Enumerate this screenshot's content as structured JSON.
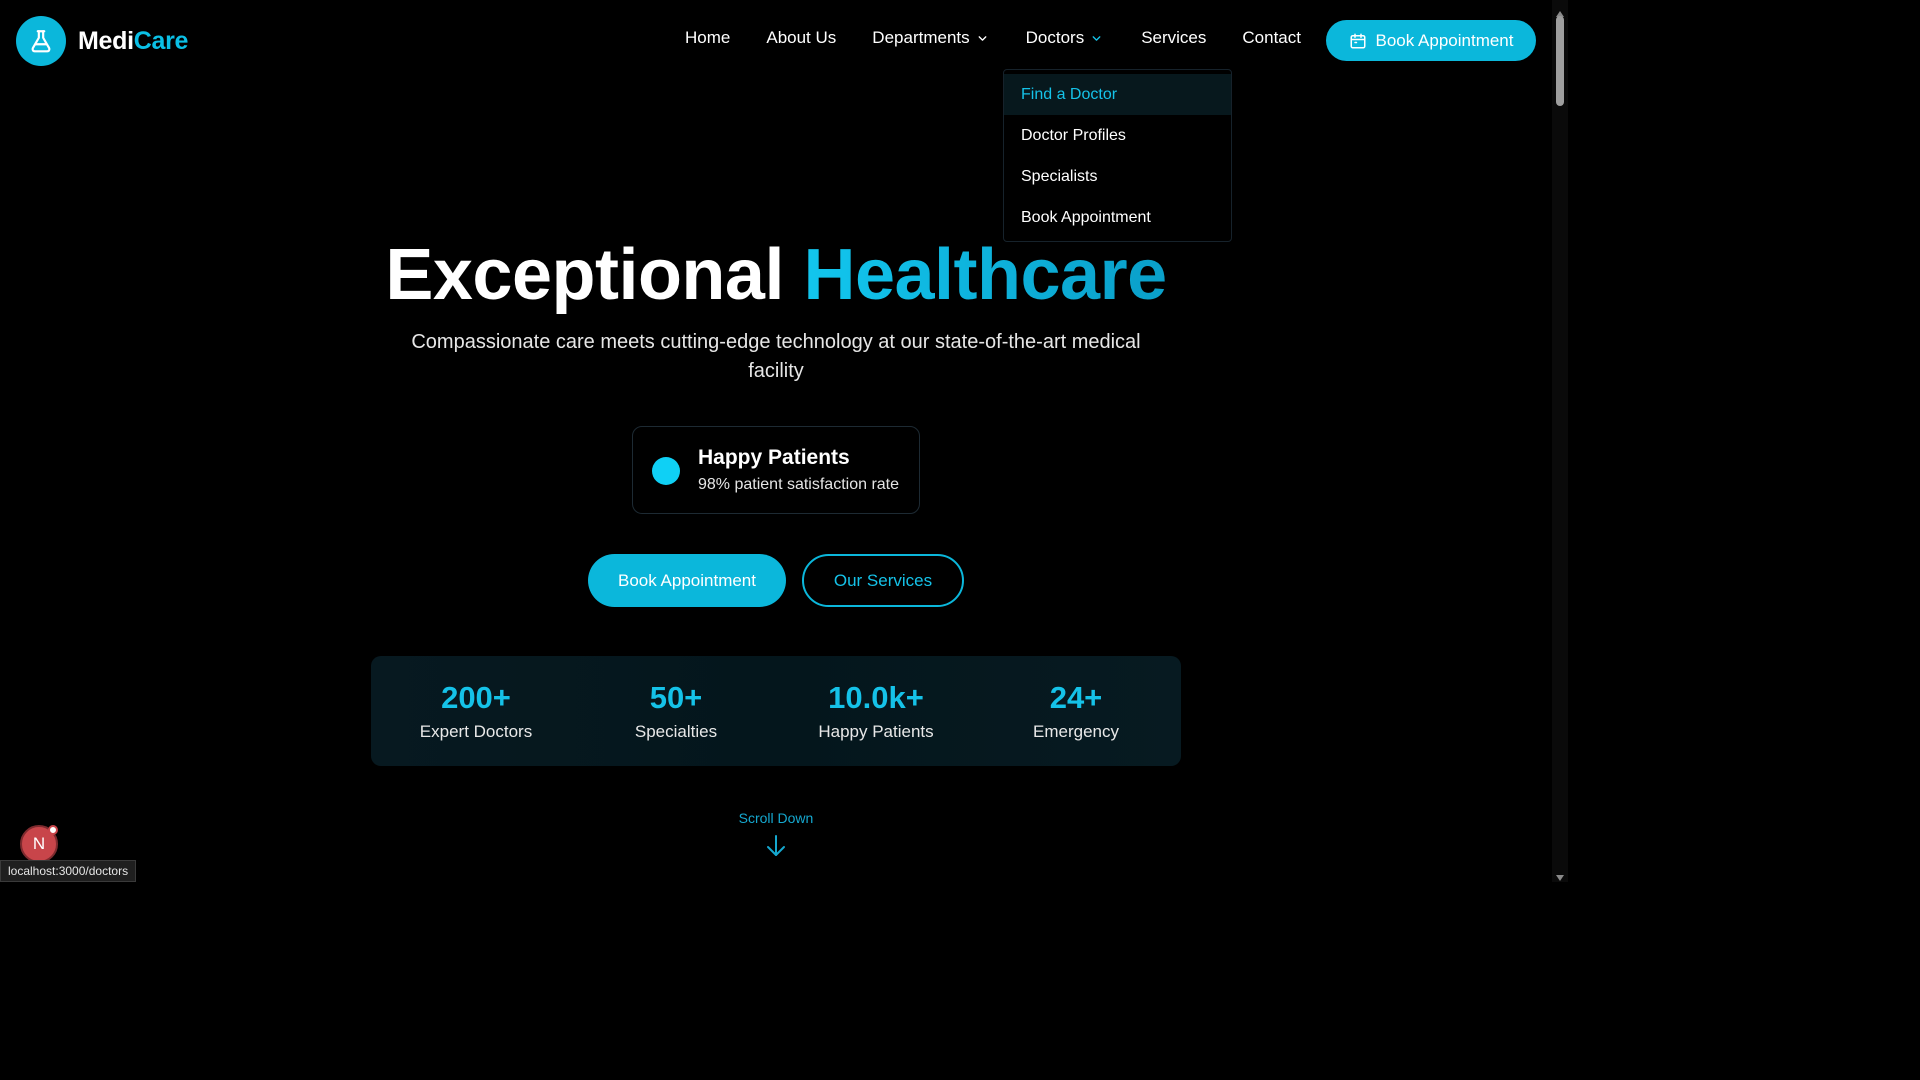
{
  "brand": {
    "name_part1": "Medi",
    "name_part2": "Care",
    "icon": "flask-icon"
  },
  "nav": {
    "items": [
      {
        "label": "Home"
      },
      {
        "label": "About Us"
      },
      {
        "label": "Departments",
        "has_dropdown": true
      },
      {
        "label": "Doctors",
        "has_dropdown": true
      },
      {
        "label": "Services"
      },
      {
        "label": "Contact"
      }
    ],
    "cta_label": "Book Appointment",
    "cta_icon": "calendar-icon"
  },
  "doctors_dropdown": {
    "items": [
      {
        "label": "Find a Doctor",
        "active": true
      },
      {
        "label": "Doctor Profiles"
      },
      {
        "label": "Specialists"
      },
      {
        "label": "Book Appointment"
      }
    ]
  },
  "hero": {
    "title_part1": "Exceptional",
    "title_part2": "Healthcare",
    "subtitle": "Compassionate care meets cutting-edge technology at our state-of-the-art medical facility",
    "highlight": {
      "title": "Happy Patients",
      "text": "98% patient satisfaction rate"
    },
    "primary_button": "Book Appointment",
    "secondary_button": "Our Services"
  },
  "stats": [
    {
      "value": "200+",
      "label": "Expert Doctors"
    },
    {
      "value": "50+",
      "label": "Specialties"
    },
    {
      "value": "10.0k+",
      "label": "Happy Patients"
    },
    {
      "value": "24+",
      "label": "Emergency"
    }
  ],
  "scroll_hint": "Scroll Down",
  "dev_badge": "N",
  "status_url": "localhost:3000/doctors",
  "colors": {
    "accent": "#0bb7db",
    "background": "#000000"
  }
}
